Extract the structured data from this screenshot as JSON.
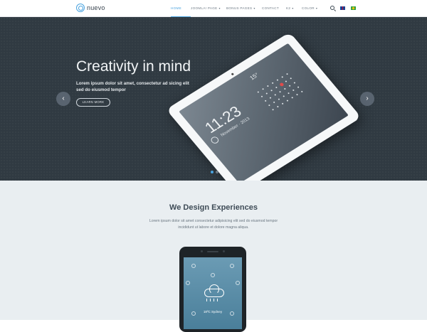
{
  "brand": {
    "name": "nuevo",
    "accent": "#4aa3df"
  },
  "nav": {
    "items": [
      {
        "label": "HOME",
        "active": true,
        "caret": ""
      },
      {
        "label": "JOOMLA! PAGE",
        "active": false,
        "caret": "▾"
      },
      {
        "label": "BONUS PAGES",
        "active": false,
        "caret": "▾"
      },
      {
        "label": "CONTACT",
        "active": false,
        "caret": ""
      },
      {
        "label": "K2",
        "active": false,
        "caret": "▾"
      },
      {
        "label": "COLOR",
        "active": false,
        "caret": "▾"
      }
    ],
    "icons": [
      "search-icon",
      "uk-flag-icon",
      "brazil-flag-icon"
    ]
  },
  "hero": {
    "title": "Creativity in mind",
    "text": "Lorem ipsum dolor sit amet, consectetur ad sicing elit sed do eiusmod tempor",
    "button": "LEARN MORE",
    "prev": "‹",
    "next": "›",
    "device": {
      "clock": "11:23",
      "date": "November · 2013",
      "weather": "15°"
    }
  },
  "content": {
    "title": "We Design Experiences",
    "text": "Lorem ipsum dolor sit amet consectetur adipisicing elit sed do eiusmod tempor incididunt ut labore et dolore magna aliqua.",
    "phone": {
      "temp": "18ºC  Sydney"
    }
  }
}
